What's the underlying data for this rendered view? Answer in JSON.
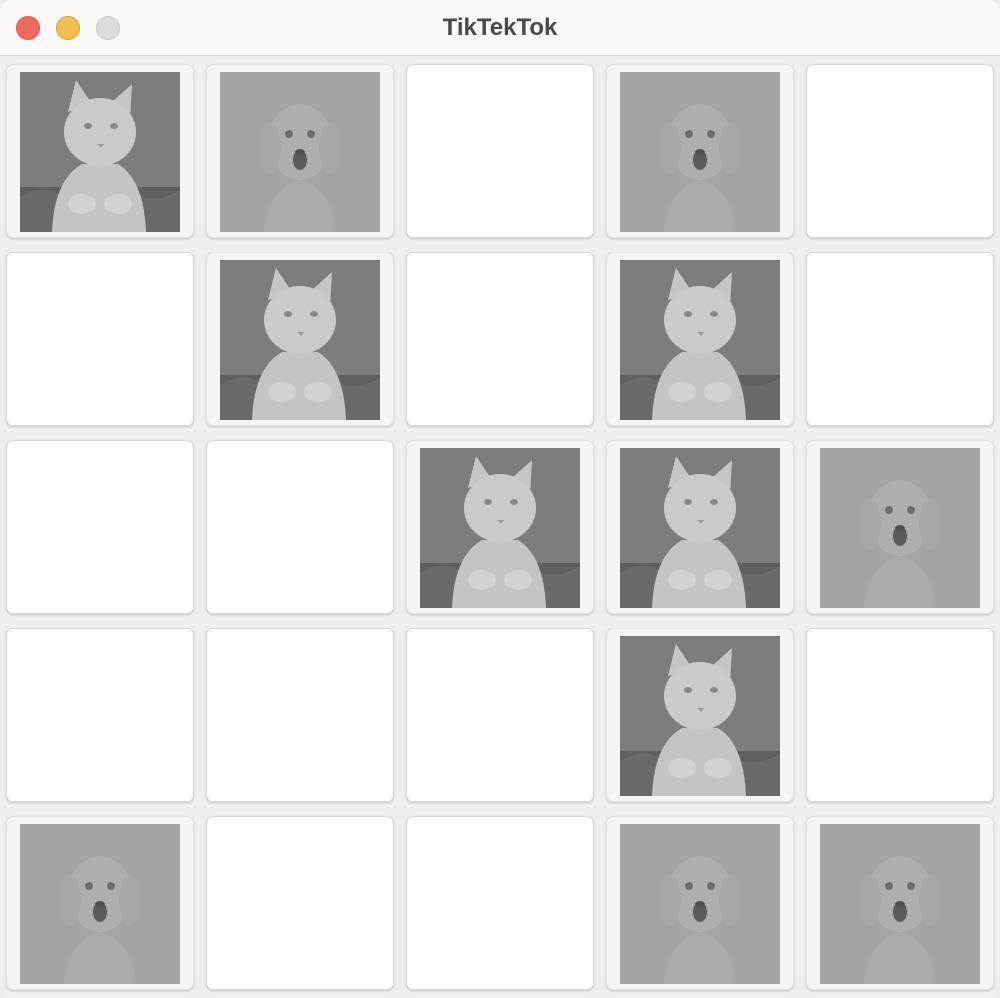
{
  "window": {
    "title": "TikTekTok",
    "buttons": {
      "close": "close-button",
      "minimize": "minimize-button",
      "zoom": "zoom-button"
    }
  },
  "board": {
    "rows": 5,
    "columns": 5,
    "tiles": [
      [
        "cat",
        "dog",
        "hidden",
        "dog",
        "hidden"
      ],
      [
        "hidden",
        "cat",
        "hidden",
        "cat",
        "hidden"
      ],
      [
        "hidden",
        "hidden",
        "cat",
        "cat",
        "dog"
      ],
      [
        "hidden",
        "hidden",
        "hidden",
        "cat",
        "hidden"
      ],
      [
        "dog",
        "hidden",
        "hidden",
        "dog",
        "dog"
      ]
    ]
  },
  "colors": {
    "cat_background": "#7d7d7d",
    "dog_background": "#a4a4a4",
    "hidden_tile": "#ffffff",
    "close": "#ee6a5f",
    "minimize": "#f5bf4f",
    "zoom": "#dcdcdc"
  }
}
